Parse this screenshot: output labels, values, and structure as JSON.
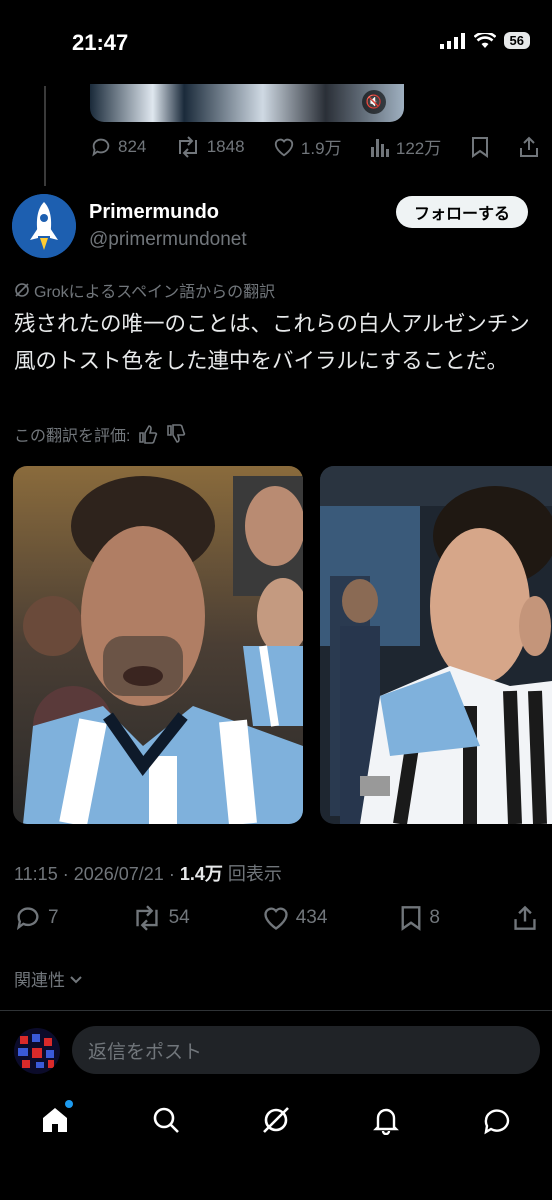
{
  "status_bar": {
    "time": "21:47",
    "battery": "56"
  },
  "previous_post": {
    "replies": "824",
    "reposts": "1848",
    "likes": "1.9万",
    "views": "122万"
  },
  "post": {
    "author_name": "Primermundo",
    "author_handle": "@primermundonet",
    "follow_label": "フォローする",
    "translation_note": "Grokによるスペイン語からの翻訳",
    "text": "残されたの唯一のことは、これらの白人アルゼンチン風のトスト色をした連中をバイラルにすることだ。",
    "rate_translation": "この翻訳を評価:",
    "time": "11:15",
    "date": "2026/07/21",
    "views_count": "1.4万",
    "views_label": "回表示",
    "replies": "7",
    "reposts": "54",
    "likes": "434",
    "bookmarks": "8"
  },
  "related_label": "関連性",
  "reply_placeholder": "返信をポスト",
  "colors": {
    "accent": "#1d9bf0",
    "muted": "#71767b",
    "text": "#e7e9ea"
  }
}
